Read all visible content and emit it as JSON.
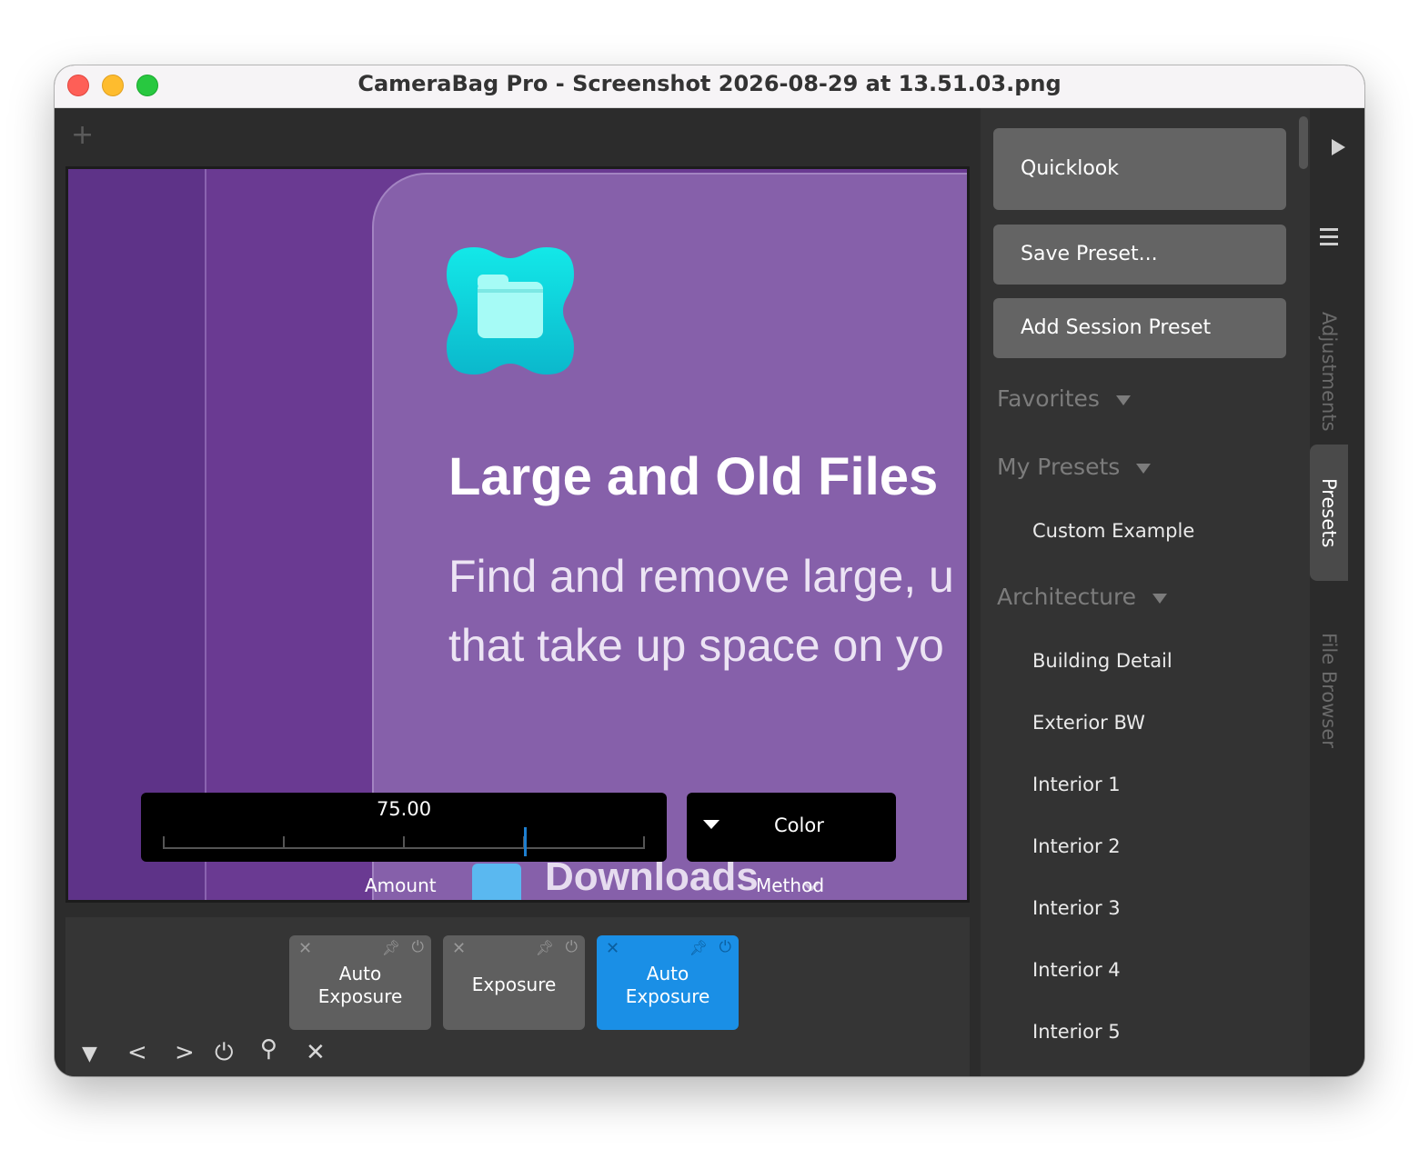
{
  "window": {
    "title": "CameraBag Pro - Screenshot 2026-08-29 at 13.51.03.png"
  },
  "workspace": {
    "new_tab_icon": "+"
  },
  "preview": {
    "heading": "Large and Old Files",
    "subtext_line1": "Find and remove large, u",
    "subtext_line2": "that take up space on yo",
    "downloads_label": "Downloads"
  },
  "controls": {
    "amount_value": "75.00",
    "amount_fraction": 0.75,
    "amount_label": "Amount",
    "method_value": "Color",
    "method_label": "Method"
  },
  "adjustments": [
    {
      "label_line1": "Auto",
      "label_line2": "Exposure",
      "active": false
    },
    {
      "label_line1": "Exposure",
      "label_line2": "",
      "active": false
    },
    {
      "label_line1": "Auto",
      "label_line2": "Exposure",
      "active": true
    }
  ],
  "bottom_tools": [
    "collapse-icon",
    "previous-icon",
    "next-icon",
    "power-icon",
    "search-icon",
    "close-icon"
  ],
  "right_panel": {
    "quicklook": "Quicklook",
    "save_preset": "Save Preset...",
    "add_session_preset": "Add Session Preset",
    "sections": {
      "favorites": "Favorites",
      "my_presets": "My Presets",
      "architecture": "Architecture"
    },
    "my_presets_items": [
      "Custom Example"
    ],
    "architecture_items": [
      "Building Detail",
      "Exterior BW",
      "Interior 1",
      "Interior 2",
      "Interior 3",
      "Interior 4",
      "Interior 5"
    ]
  },
  "side_tabs": {
    "adjustments": "Adjustments",
    "presets": "Presets",
    "file_browser": "File Browser"
  }
}
